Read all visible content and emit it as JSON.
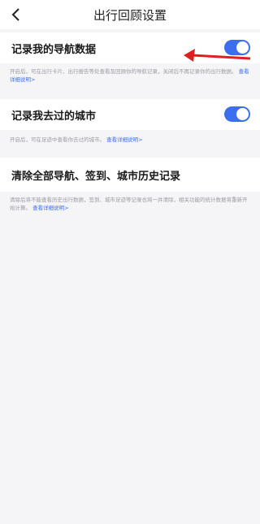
{
  "header": {
    "title": "出行回顾设置",
    "back_icon": "chevron-left-icon"
  },
  "sections": [
    {
      "title": "记录我的导航数据",
      "toggle_on": true,
      "desc": "开启后，可在出行卡片、出行报告等处查看及回顾你的导航记录，关闭后不再记录你的出行数据。",
      "link": "查看详细说明>"
    },
    {
      "title": "记录我去过的城市",
      "toggle_on": true,
      "desc": "开启后，可在足迹中查看你去过的城市。",
      "link": "查看详细说明>"
    },
    {
      "title": "清除全部导航、签到、城市历史记录",
      "desc": "清除后将不能查看历史出行数据，签到、城市足迹等记录也将一并清除，相关功能的统计数据将重新开始计算。",
      "link": "查看详细说明>"
    }
  ],
  "colors": {
    "accent": "#3d6ef0",
    "annotation_arrow": "#e02020",
    "background": "#f5f5f7"
  }
}
